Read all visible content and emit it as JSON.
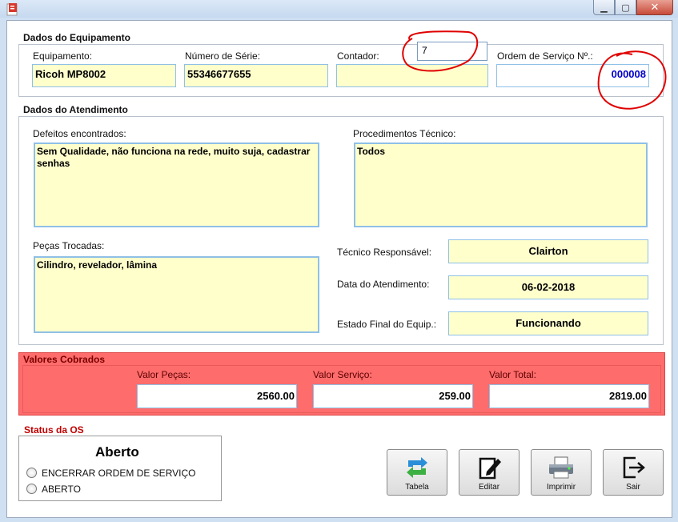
{
  "window": {
    "buttons": {
      "minimize": "▁",
      "maximize": "▢",
      "close": "✕"
    }
  },
  "equipamento": {
    "section_title": "Dados do Equipamento",
    "equip_label": "Equipamento:",
    "equip_value": "Ricoh MP8002",
    "serie_label": "Número de Série:",
    "serie_value": "55346677655",
    "contador_label": "Contador:",
    "contador_value": "",
    "contador_popup_value": "7",
    "os_label": "Ordem de Serviço Nº.:",
    "os_value": "000008"
  },
  "atendimento": {
    "section_title": "Dados do Atendimento",
    "defeitos_label": "Defeitos encontrados:",
    "defeitos_value": "Sem Qualidade, não funciona na rede, muito suja, cadastrar senhas",
    "procedimentos_label": "Procedimentos Técnico:",
    "procedimentos_value": "Todos",
    "pecas_label": "Peças Trocadas:",
    "pecas_value": "Cilindro, revelador, lâmina",
    "tecnico_label": "Técnico Responsável:",
    "tecnico_value": "Clairton",
    "data_label": "Data do Atendimento:",
    "data_value": "06-02-2018",
    "estado_label": "Estado Final do Equip.:",
    "estado_value": "Funcionando"
  },
  "valores": {
    "section_title": "Valores Cobrados",
    "pecas_label": "Valor Peças:",
    "pecas_value": "2560.00",
    "servico_label": "Valor Serviço:",
    "servico_value": "259.00",
    "total_label": "Valor Total:",
    "total_value": "2819.00"
  },
  "status": {
    "section_title": "Status da OS",
    "current": "Aberto",
    "options": [
      "ENCERRAR ORDEM DE SERVIÇO",
      "ABERTO"
    ]
  },
  "actions": {
    "tabela": "Tabela",
    "editar": "Editar",
    "imprimir": "Imprimir",
    "sair": "Sair"
  },
  "colors": {
    "field_bg": "#ffffcc",
    "field_border": "#8fc0e6",
    "valores_bg": "#ff6c6c",
    "status_title": "#c00000",
    "os_number": "#0000cc",
    "annotation": "#e00000"
  },
  "icons": {
    "app": "app-icon",
    "tabela": "refresh-arrows-icon",
    "editar": "edit-note-icon",
    "imprimir": "printer-icon",
    "sair": "exit-door-icon"
  }
}
